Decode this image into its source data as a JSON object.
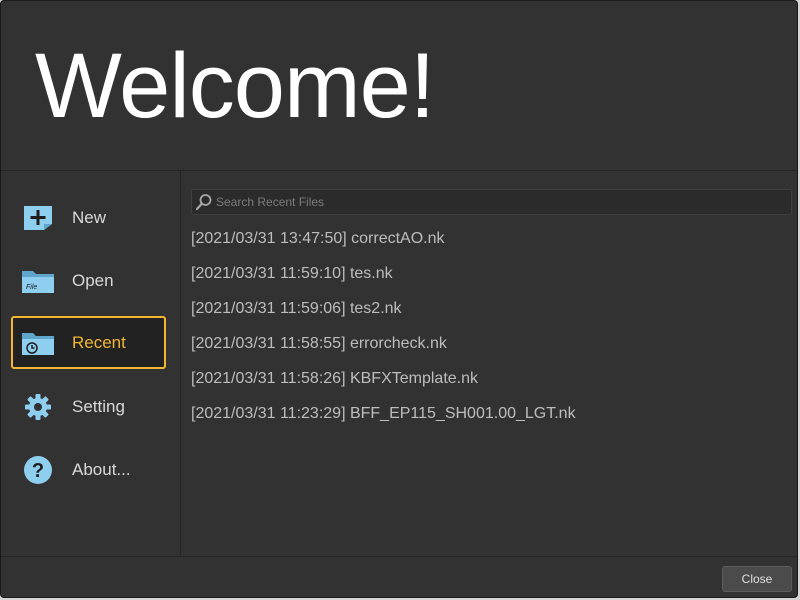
{
  "header": {
    "title": "Welcome!"
  },
  "sidebar": {
    "items": [
      {
        "label": "New",
        "icon": "new-file-icon",
        "active": false
      },
      {
        "label": "Open",
        "icon": "open-folder-icon",
        "active": false
      },
      {
        "label": "Recent",
        "icon": "recent-folder-icon",
        "active": true
      },
      {
        "label": "Setting",
        "icon": "gear-icon",
        "active": false
      },
      {
        "label": "About...",
        "icon": "help-icon",
        "active": false
      }
    ]
  },
  "search": {
    "placeholder": "Search Recent Files",
    "value": ""
  },
  "recent_files": [
    "[2021/03/31 13:47:50] correctAO.nk",
    "[2021/03/31 11:59:10] tes.nk",
    "[2021/03/31 11:59:06] tes2.nk",
    "[2021/03/31 11:58:55] errorcheck.nk",
    "[2021/03/31 11:58:26] KBFXTemplate.nk",
    "[2021/03/31 11:23:29] BFF_EP115_SH001.00_LGT.nk"
  ],
  "footer": {
    "close_label": "Close"
  },
  "colors": {
    "background": "#323232",
    "accent": "#f2b632",
    "icon_blue": "#8ecff0",
    "text": "#bdbdbd"
  }
}
